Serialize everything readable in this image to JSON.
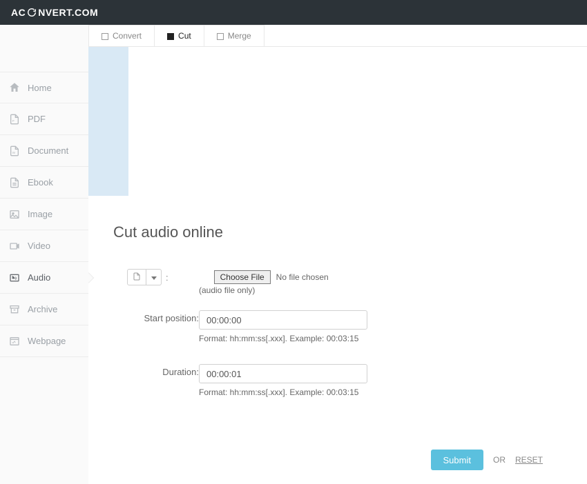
{
  "brand": {
    "left": "AC",
    "right": "NVERT.COM"
  },
  "sidebar": {
    "items": [
      {
        "label": "Home"
      },
      {
        "label": "PDF"
      },
      {
        "label": "Document"
      },
      {
        "label": "Ebook"
      },
      {
        "label": "Image"
      },
      {
        "label": "Video"
      },
      {
        "label": "Audio"
      },
      {
        "label": "Archive"
      },
      {
        "label": "Webpage"
      }
    ]
  },
  "tabs": {
    "convert": "Convert",
    "cut": "Cut",
    "merge": "Merge"
  },
  "page": {
    "title": "Cut audio online",
    "choose_file": "Choose File",
    "no_file": "No file chosen",
    "audio_only": "(audio file only)",
    "start_label": "Start position:",
    "start_value": "00:00:00",
    "start_hint": "Format: hh:mm:ss[.xxx]. Example: 00:03:15",
    "duration_label": "Duration:",
    "duration_value": "00:00:01",
    "duration_hint": "Format: hh:mm:ss[.xxx]. Example: 00:03:15",
    "submit": "Submit",
    "or": "OR",
    "reset": "RESET"
  }
}
